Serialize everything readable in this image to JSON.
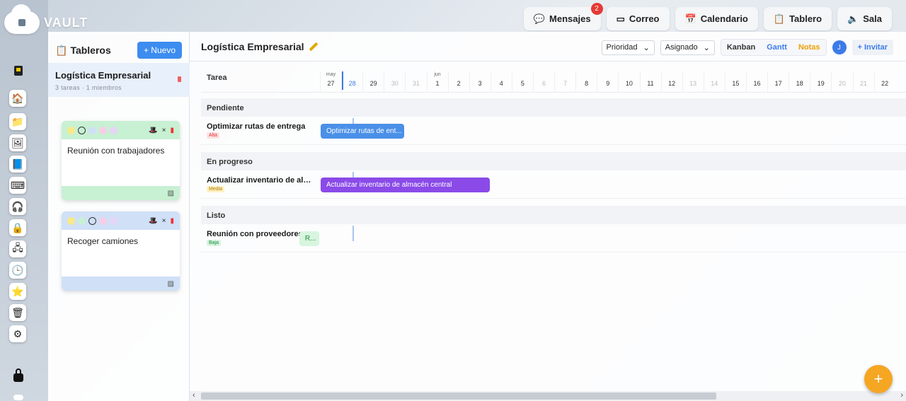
{
  "app": {
    "logo_text": "VAULT"
  },
  "topnav": [
    {
      "label": "Mensajes",
      "icon": "chat-icon",
      "glyph": "💬",
      "badge": "2"
    },
    {
      "label": "Correo",
      "icon": "mail-icon",
      "glyph": "▭"
    },
    {
      "label": "Calendario",
      "icon": "calendar-icon",
      "glyph": "📅"
    },
    {
      "label": "Tablero",
      "icon": "clipboard-icon",
      "glyph": "📋"
    },
    {
      "label": "Sala",
      "icon": "speaker-icon",
      "glyph": "🔈"
    }
  ],
  "rail": {
    "icons": [
      {
        "name": "home-icon",
        "glyph": "🏠"
      },
      {
        "name": "folder-icon",
        "glyph": "📁"
      },
      {
        "name": "image-icon",
        "glyph": "🖼"
      },
      {
        "name": "document-icon",
        "glyph": "📘"
      },
      {
        "name": "keyboard-icon",
        "glyph": "⌨"
      },
      {
        "name": "headphones-icon",
        "glyph": "🎧"
      },
      {
        "name": "lock-icon",
        "glyph": "🔒"
      },
      {
        "name": "network-icon",
        "glyph": "🖧"
      },
      {
        "name": "clock-icon",
        "glyph": "🕒"
      },
      {
        "name": "star-icon",
        "glyph": "⭐"
      },
      {
        "name": "trash-icon",
        "glyph": "🗑"
      },
      {
        "name": "settings-icon",
        "glyph": "⚙"
      }
    ]
  },
  "boards_panel": {
    "title": "Tableros",
    "new_button": "+ Nuevo",
    "board": {
      "name": "Logística Empresarial",
      "meta": "3 tareas · 1 miembros"
    },
    "notes": [
      {
        "text": "Reunión con  trabajadores",
        "color": "#c8f0d3",
        "foot_color": "#c8f0d3"
      },
      {
        "text": "Recoger camiones",
        "color": "#cfe0f7",
        "foot_color": "#cfe0f7"
      }
    ]
  },
  "main": {
    "title": "Logística Empresarial",
    "priority_select": "Prioridad",
    "assigned_select": "Asignado",
    "views": [
      {
        "label": "Kanban",
        "color": "#333"
      },
      {
        "label": "Gantt",
        "color": "#3d7be8"
      },
      {
        "label": "Notas",
        "color": "#f0a000"
      }
    ],
    "avatar": "J",
    "invite": "+ Invitar"
  },
  "gantt": {
    "task_header": "Tarea",
    "days": [
      {
        "month": "may",
        "day": "27",
        "type": "normal"
      },
      {
        "month": "",
        "day": "28",
        "type": "today"
      },
      {
        "month": "",
        "day": "29",
        "type": "normal"
      },
      {
        "month": "",
        "day": "30",
        "type": "weekend"
      },
      {
        "month": "",
        "day": "31",
        "type": "weekend"
      },
      {
        "month": "jun",
        "day": "1",
        "type": "normal"
      },
      {
        "month": "",
        "day": "2",
        "type": "normal"
      },
      {
        "month": "",
        "day": "3",
        "type": "normal"
      },
      {
        "month": "",
        "day": "4",
        "type": "normal"
      },
      {
        "month": "",
        "day": "5",
        "type": "normal"
      },
      {
        "month": "",
        "day": "6",
        "type": "weekend"
      },
      {
        "month": "",
        "day": "7",
        "type": "weekend"
      },
      {
        "month": "",
        "day": "8",
        "type": "normal"
      },
      {
        "month": "",
        "day": "9",
        "type": "normal"
      },
      {
        "month": "",
        "day": "10",
        "type": "normal"
      },
      {
        "month": "",
        "day": "11",
        "type": "normal"
      },
      {
        "month": "",
        "day": "12",
        "type": "normal"
      },
      {
        "month": "",
        "day": "13",
        "type": "weekend"
      },
      {
        "month": "",
        "day": "14",
        "type": "weekend"
      },
      {
        "month": "",
        "day": "15",
        "type": "normal"
      },
      {
        "month": "",
        "day": "16",
        "type": "normal"
      },
      {
        "month": "",
        "day": "17",
        "type": "normal"
      },
      {
        "month": "",
        "day": "18",
        "type": "normal"
      },
      {
        "month": "",
        "day": "19",
        "type": "normal"
      },
      {
        "month": "",
        "day": "20",
        "type": "weekend"
      },
      {
        "month": "",
        "day": "21",
        "type": "weekend"
      },
      {
        "month": "",
        "day": "22",
        "type": "normal"
      }
    ],
    "groups": [
      {
        "label": "Pendiente",
        "task": {
          "name": "Optimizar rutas de entrega",
          "priority": "Alta",
          "priority_class": "alta",
          "bar_label": "Optimizar rutas de ent...",
          "bar_color": "#4a90e8",
          "start_day": 0,
          "duration_days": 4
        }
      },
      {
        "label": "En progreso",
        "task": {
          "name": "Actualizar inventario de alm...",
          "priority": "Media",
          "priority_class": "media",
          "bar_label": "Actualizar inventario de almacén central",
          "bar_color": "#8a4ae8",
          "start_day": 0,
          "duration_days": 8
        }
      },
      {
        "label": "Listo",
        "task": {
          "name": "Reunión con proveedores",
          "priority": "Baja",
          "priority_class": "baja",
          "bar_label": "R...",
          "bar_color": "#d8f5df",
          "start_day": -1,
          "duration_days": 1
        }
      }
    ]
  },
  "fab": "+"
}
